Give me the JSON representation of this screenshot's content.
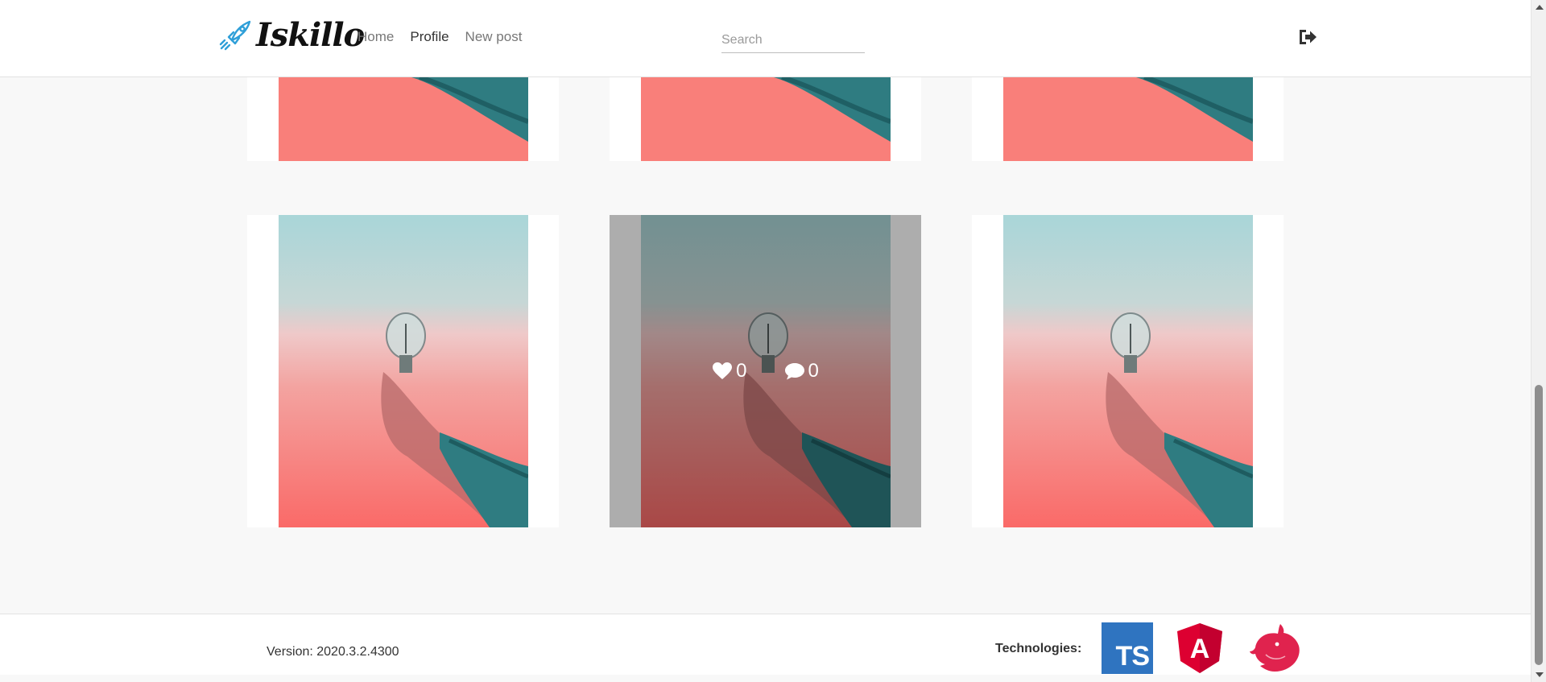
{
  "header": {
    "logo_text": "Iskillo",
    "nav": [
      {
        "label": "Home",
        "active": false
      },
      {
        "label": "Profile",
        "active": true
      },
      {
        "label": "New post",
        "active": false
      }
    ],
    "search": {
      "placeholder": "Search",
      "value": ""
    },
    "logout_icon": "sign-out-icon"
  },
  "posts": [
    {
      "row": 1,
      "col": 1
    },
    {
      "row": 1,
      "col": 2
    },
    {
      "row": 1,
      "col": 3
    },
    {
      "row": 2,
      "col": 1
    },
    {
      "row": 2,
      "col": 2,
      "hovered": true,
      "likes": "0",
      "comments": "0"
    },
    {
      "row": 2,
      "col": 3
    }
  ],
  "hover_stats": {
    "likes": "0",
    "comments": "0"
  },
  "footer": {
    "version": "Version: 2020.3.2.4300",
    "technologies_label": "Technologies:",
    "ts_label": "TS",
    "angular_letter": "A",
    "technologies": [
      "typescript-logo",
      "angular-logo",
      "nestjs-logo"
    ]
  },
  "colors": {
    "accent": "#2f9fd8",
    "ts_blue": "#2f74c0",
    "angular_red": "#dd0031",
    "nest_red": "#e0234e"
  }
}
